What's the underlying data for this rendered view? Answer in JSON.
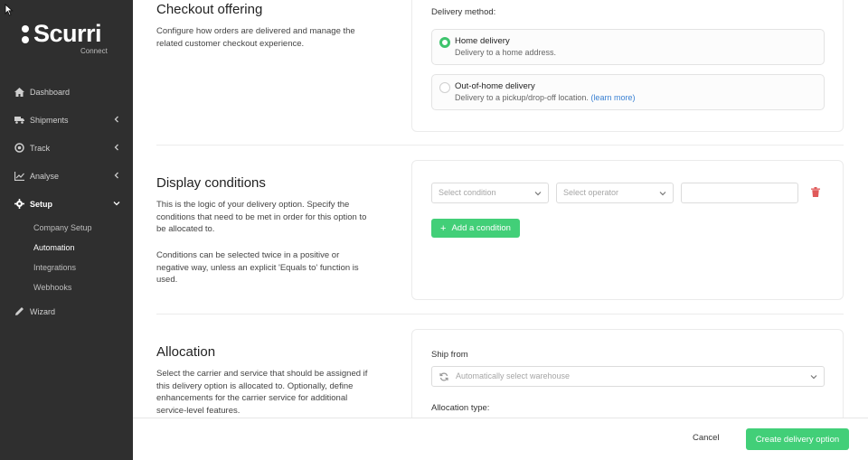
{
  "brand": {
    "name": "Scurri",
    "sub": "Connect"
  },
  "nav": {
    "items": [
      {
        "label": "Dashboard",
        "icon": "home-icon"
      },
      {
        "label": "Shipments",
        "icon": "truck-icon"
      },
      {
        "label": "Track",
        "icon": "target-icon"
      },
      {
        "label": "Analyse",
        "icon": "chart-icon"
      },
      {
        "label": "Setup",
        "icon": "gear-icon"
      },
      {
        "label": "Wizard",
        "icon": "pencil-icon"
      }
    ],
    "setup_sub": [
      "Company Setup",
      "Automation",
      "Integrations",
      "Webhooks"
    ]
  },
  "checkout": {
    "title": "Checkout offering",
    "desc": "Configure how orders are delivered and manage the related customer checkout experience.",
    "delivery_label": "Delivery method:",
    "options": [
      {
        "title": "Home delivery",
        "desc": "Delivery to a home address.",
        "selected": true
      },
      {
        "title": "Out-of-home delivery",
        "desc": "Delivery to a pickup/drop-off location.",
        "link": "(learn more)",
        "selected": false
      }
    ]
  },
  "conditions": {
    "title": "Display conditions",
    "desc1": "This is the logic of your delivery option. Specify the conditions that need to be met in order for this option to be allocated to.",
    "desc2": "Conditions can be selected twice in a positive or negative way, unless an explicit 'Equals to' function is used.",
    "condition_placeholder": "Select condition",
    "operator_placeholder": "Select operator",
    "value": "",
    "add_label": "Add a condition"
  },
  "allocation": {
    "title": "Allocation",
    "desc": "Select the carrier and service that should be assigned if this delivery option is allocated to. Optionally, define enhancements for the carrier service for additional service-level features.",
    "ship_from_label": "Ship from",
    "ship_from_value": "Automatically select warehouse",
    "allocation_type_label": "Allocation type:"
  },
  "footer": {
    "cancel": "Cancel",
    "create": "Create delivery option"
  },
  "colors": {
    "accent": "#42cf78",
    "sidebar": "#2f2f2f",
    "link": "#3a80d2",
    "danger": "#e05a5a"
  }
}
